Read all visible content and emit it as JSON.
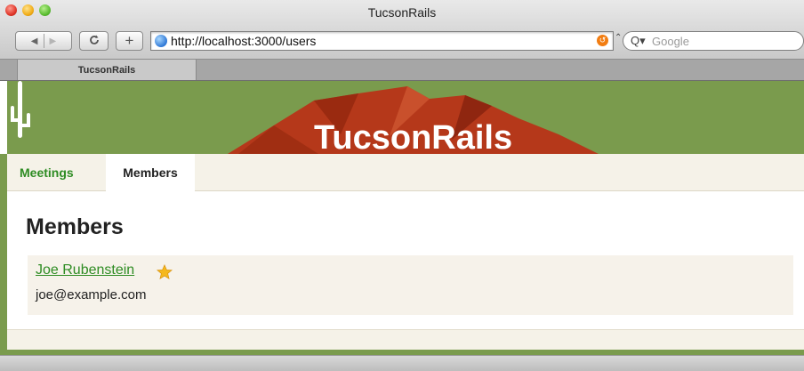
{
  "window": {
    "title": "TucsonRails"
  },
  "toolbar": {
    "reload_glyph": "C",
    "add_glyph": "+",
    "back_glyph": "◀",
    "forward_glyph": "▶"
  },
  "address": {
    "url": "http://localhost:3000/users"
  },
  "search": {
    "placeholder": "Google"
  },
  "tabs": [
    {
      "label": "TucsonRails"
    }
  ],
  "site": {
    "brand": "TucsonRails",
    "colors": {
      "header_green": "#7a9b4d",
      "mountain_red": "#b5381a",
      "link_green": "#2e8c23",
      "nav_bg": "#f5f2e8"
    }
  },
  "nav": {
    "items": [
      {
        "label": "Meetings",
        "active": false
      },
      {
        "label": "Members",
        "active": true
      }
    ]
  },
  "main": {
    "title": "Members",
    "members": [
      {
        "name": "Joe Rubenstein",
        "email": "joe@example.com",
        "starred": true
      }
    ]
  }
}
